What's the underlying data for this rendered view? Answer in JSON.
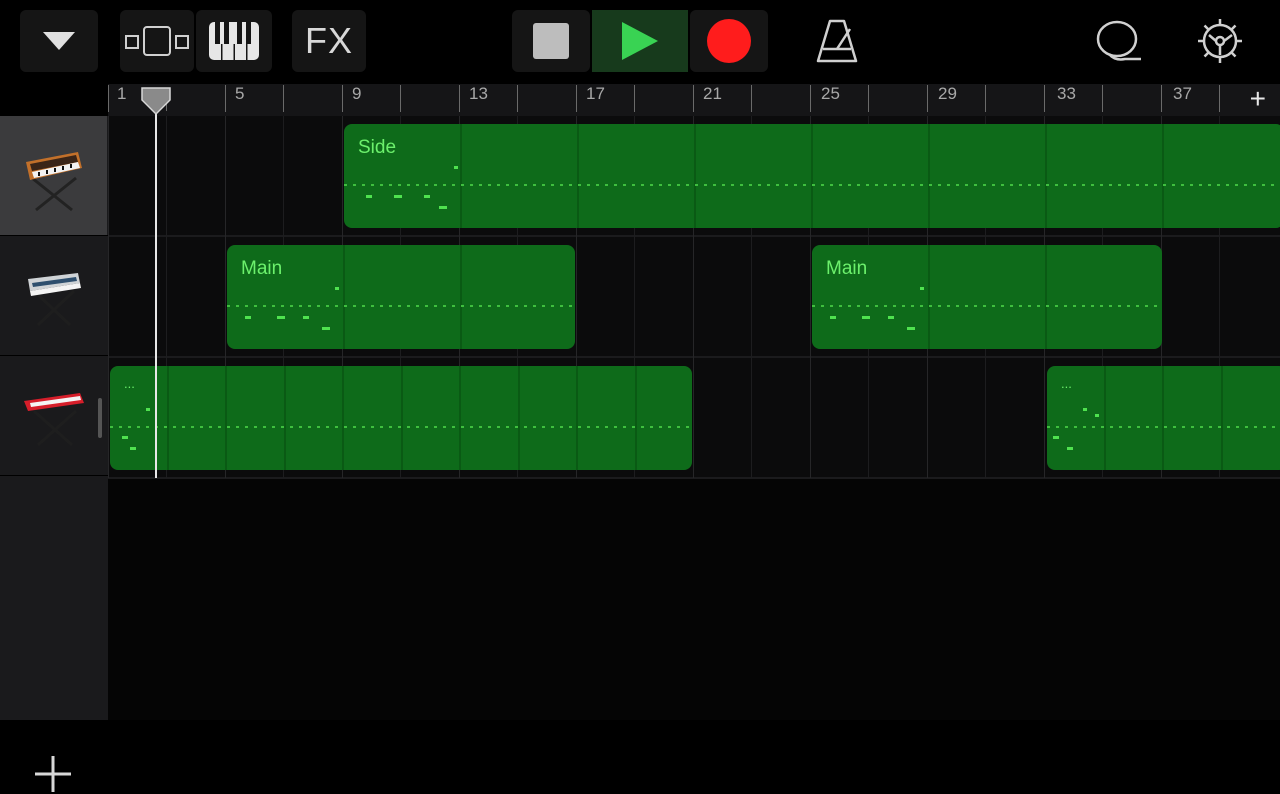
{
  "toolbar": {
    "fx_label": "FX",
    "icons": [
      "dropdown-triangle-icon",
      "view-toggle-icon",
      "piano-keys-icon",
      "stop-icon",
      "play-icon",
      "record-icon",
      "metronome-icon",
      "loop-lasso-icon",
      "settings-gear-icon"
    ],
    "colors": {
      "play": "#39d353",
      "record": "#ff1c1c",
      "stop": "#bdbdbd"
    }
  },
  "ruler": {
    "bars": [
      "1",
      "5",
      "9",
      "13",
      "17",
      "21",
      "25",
      "29",
      "33",
      "37"
    ],
    "add_section_label": "+"
  },
  "tracks": [
    {
      "instrument": "vintage-synth-icon",
      "selected": true
    },
    {
      "instrument": "keyboard-synth-icon",
      "selected": false
    },
    {
      "instrument": "red-stage-keyboard-icon",
      "selected": false
    }
  ],
  "regions": {
    "side": {
      "title": "Side"
    },
    "main1": {
      "title": "Main"
    },
    "main2": {
      "title": "Main"
    },
    "r3a": {
      "title": "..."
    },
    "r3b": {
      "title": "..."
    }
  },
  "add_track_label": "+"
}
